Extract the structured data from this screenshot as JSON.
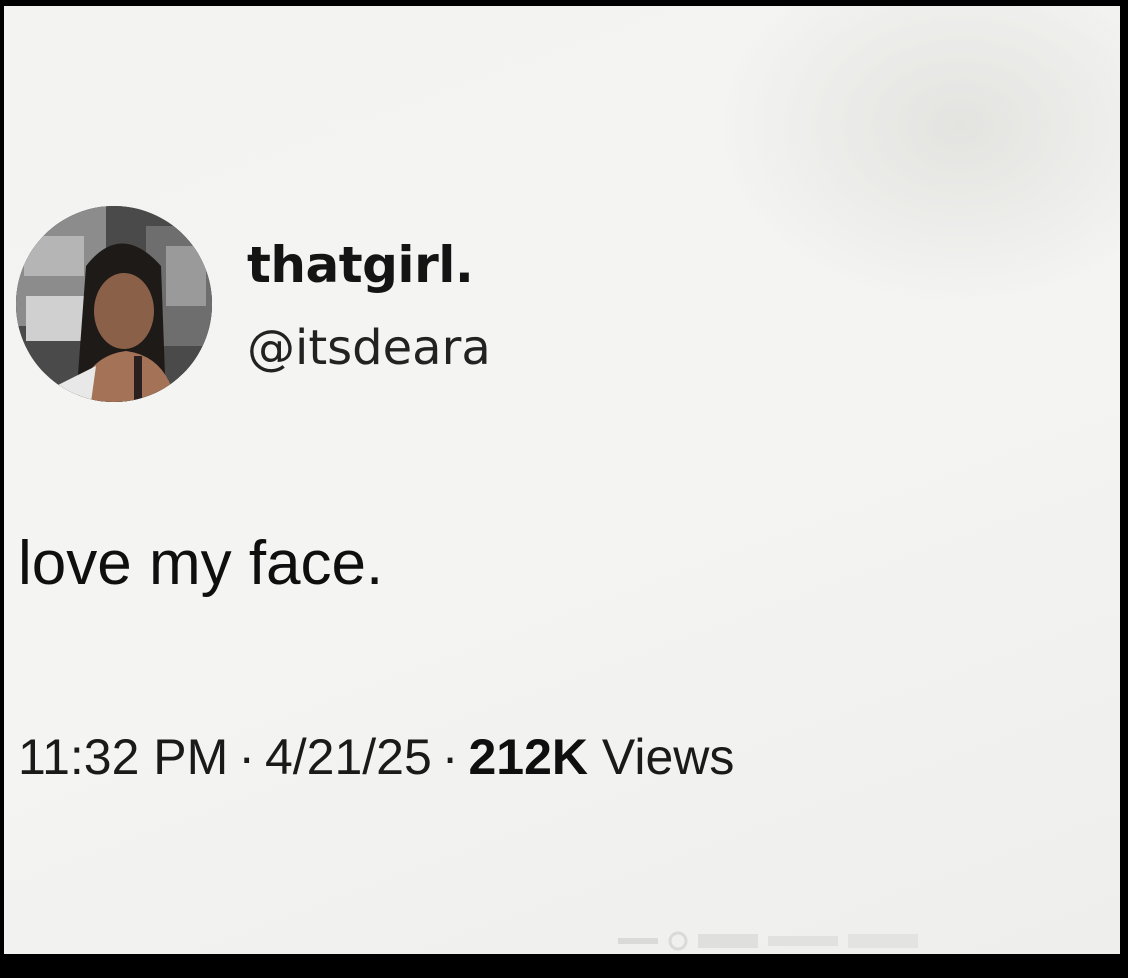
{
  "author": {
    "display_name": "thatgirl.",
    "handle": "@itsdeara",
    "avatar": "profile-photo"
  },
  "tweet": {
    "text": "love my face."
  },
  "meta": {
    "time": "11:32 PM",
    "separator": "·",
    "date": "4/21/25",
    "views_count": "212K",
    "views_label": "Views"
  },
  "colors": {
    "background": "#f3f3f1",
    "text": "#0f0f0f",
    "frame": "#000000"
  }
}
